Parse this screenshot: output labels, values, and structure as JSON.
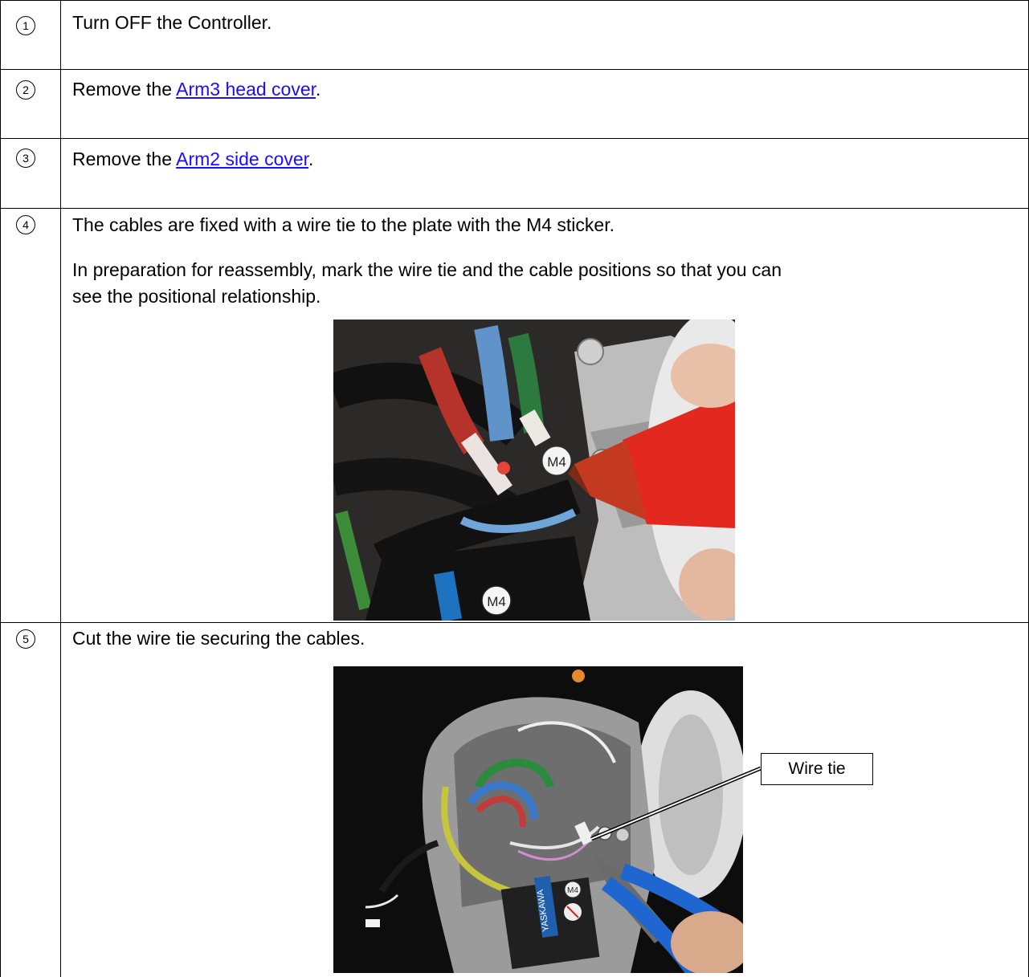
{
  "steps": [
    {
      "number": "1",
      "text": "Turn OFF the Controller."
    },
    {
      "number": "2",
      "prefix": "Remove the ",
      "link": "Arm3 head cover",
      "suffix": "."
    },
    {
      "number": "3",
      "prefix": "Remove the ",
      "link": "Arm2 side cover",
      "suffix": "."
    },
    {
      "number": "4",
      "line1": "The cables are fixed with a wire tie to the plate with the M4 sticker.",
      "line2": "In preparation for reassembly, mark the wire tie and the cable positions so that you can",
      "line3": "see the positional relationship.",
      "photo_labels": [
        "M4",
        "M4"
      ]
    },
    {
      "number": "5",
      "text": "Cut the wire tie securing the cables.",
      "callout": "Wire tie",
      "photo_labels": [
        "YASKAWA",
        "M4"
      ]
    }
  ]
}
